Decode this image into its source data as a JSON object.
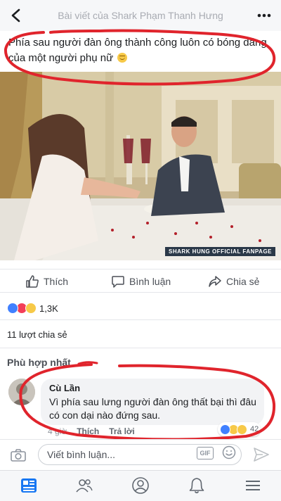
{
  "header": {
    "title": "Bài viết của Shark Phạm Thanh Hưng",
    "back_icon": "back-chevron-icon",
    "more_icon": "more-dots-icon"
  },
  "post": {
    "caption": "Phía sau người đàn ông thành công luôn có bóng dáng của một người phụ nữ",
    "caption_emoji": "smile-emoji",
    "photo_watermark": "SHARK HUNG OFFICIAL FANPAGE"
  },
  "actions": {
    "like": "Thích",
    "comment": "Bình luận",
    "share": "Chia sẻ"
  },
  "reactions": {
    "count": "1,3K",
    "types": [
      "like",
      "love",
      "haha"
    ]
  },
  "shares": "11 lượt chia sẻ",
  "comments_filter": "Phù hợp nhất",
  "comment": {
    "author": "Cù Lần",
    "text": "Vì phía sau lưng người đàn ông thất bại thì đâu có con dại nào đứng sau.",
    "time": "4 giờ",
    "like": "Thích",
    "reply": "Trả lời",
    "reaction_count": "42"
  },
  "composer": {
    "placeholder": "Viết bình luận...",
    "gif": "GIF"
  },
  "tabbar": [
    "news-feed-icon",
    "friends-icon",
    "profile-icon",
    "notifications-bell-icon",
    "menu-icon"
  ],
  "colors": {
    "accent": "#1877f2",
    "annotation_red": "#e0242c"
  }
}
